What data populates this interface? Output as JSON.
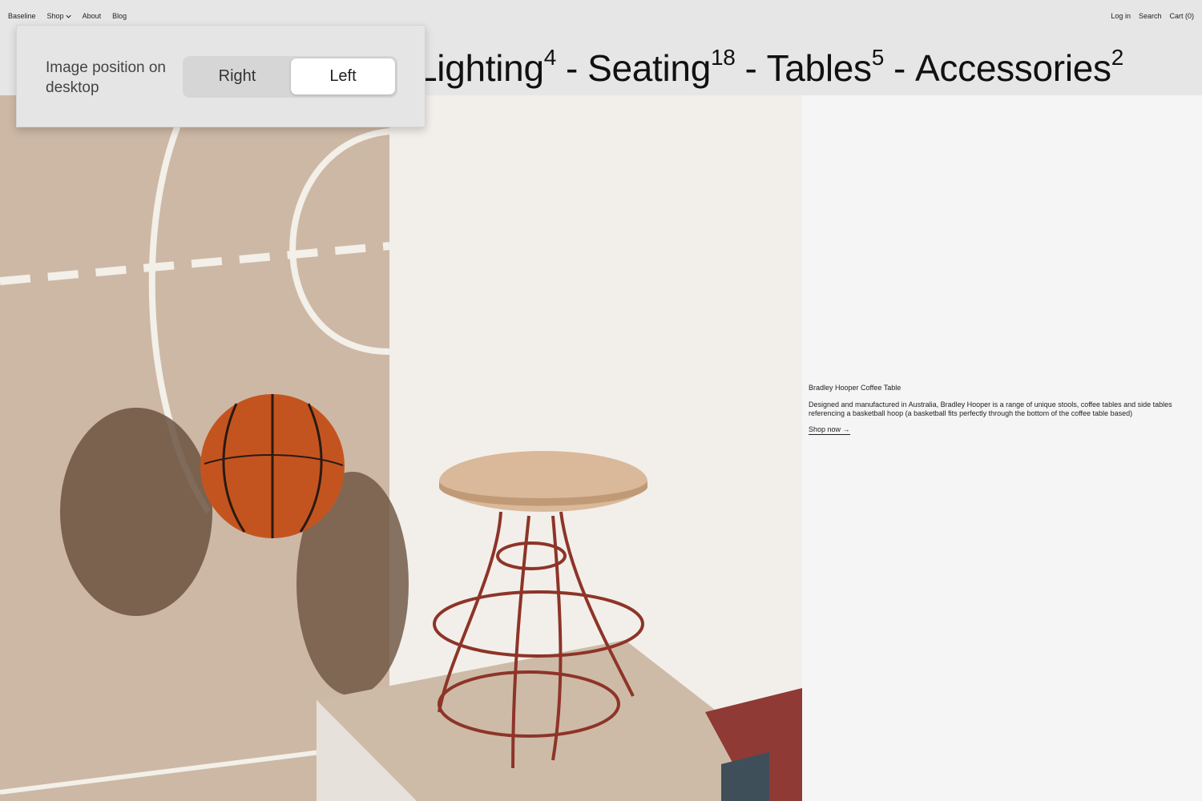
{
  "nav": {
    "brand": "Baseline",
    "shop": "Shop",
    "about": "About",
    "blog": "Blog",
    "login": "Log in",
    "search": "Search",
    "cart": "Cart (0)"
  },
  "categories": [
    {
      "label": "Lighting",
      "count": "4"
    },
    {
      "label": "Seating",
      "count": "18"
    },
    {
      "label": "Tables",
      "count": "5"
    },
    {
      "label": "Accessories",
      "count": "2"
    }
  ],
  "separator": "-",
  "product": {
    "title": "Bradley Hooper Coffee Table",
    "description": "Designed and manufactured in Australia, Bradley Hooper is a range of unique stools, coffee tables and side tables referencing a basketball hoop (a basketball fits perfectly through the bottom of the coffee table based)",
    "cta": "Shop now →"
  },
  "setting": {
    "label": "Image position on desktop",
    "options": [
      "Right",
      "Left"
    ],
    "selected": "Left"
  }
}
